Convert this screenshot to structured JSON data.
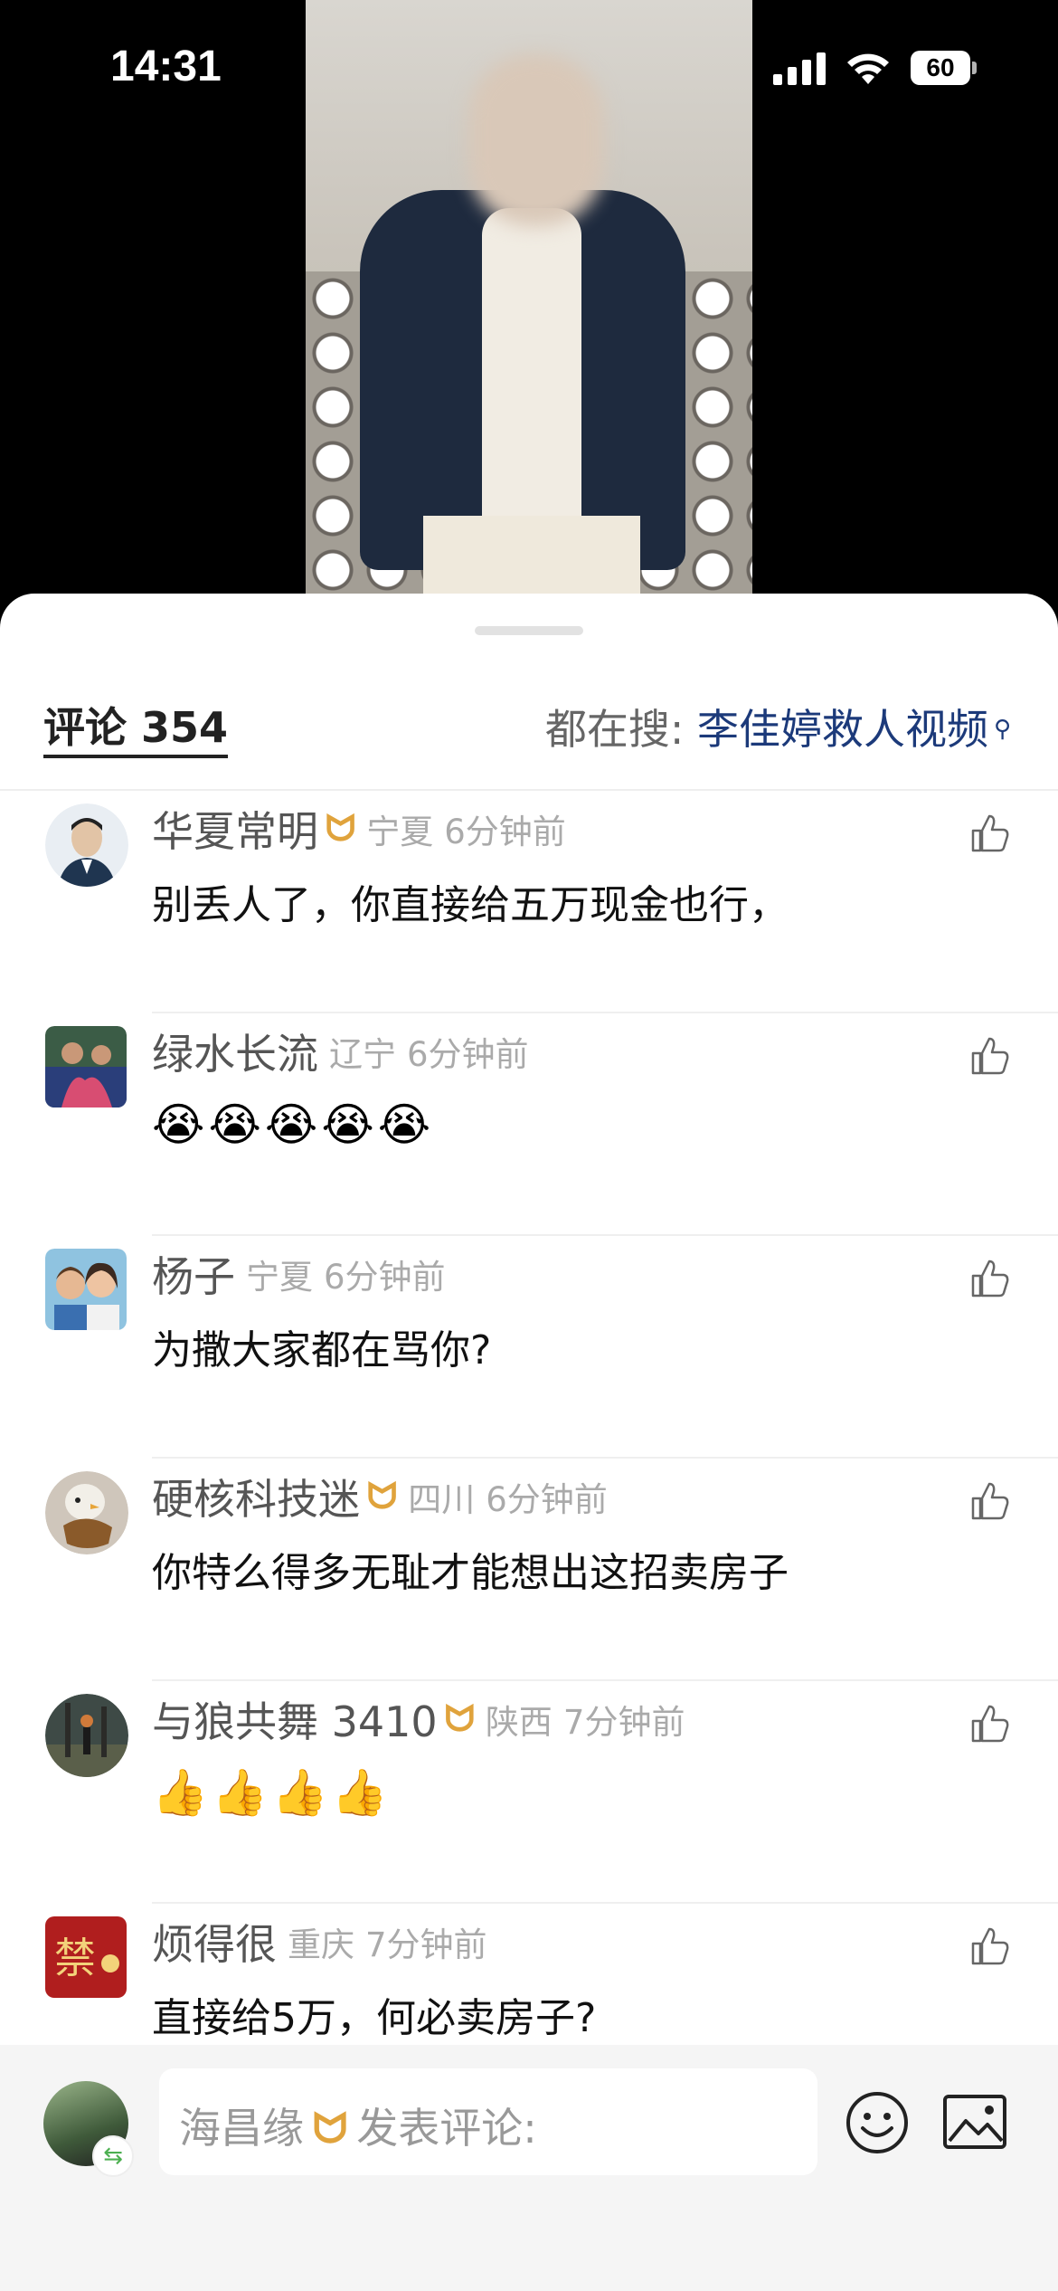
{
  "status": {
    "time": "14:31",
    "battery": "60"
  },
  "header": {
    "comments_label": "评论 354",
    "search_label": "都在搜:",
    "search_term": "李佳婷救人视频",
    "search_icon": "search-icon"
  },
  "comments": [
    {
      "name": "华夏常明",
      "vip": true,
      "region": "宁夏",
      "time": "6分钟前",
      "text": "别丢人了，你直接给五万现金也行，",
      "emojis": []
    },
    {
      "name": "绿水长流",
      "vip": false,
      "region": "辽宁",
      "time": "6分钟前",
      "text": "",
      "emojis": [
        "😭",
        "😭",
        "😭",
        "😭",
        "😭"
      ]
    },
    {
      "name": "杨子",
      "vip": false,
      "region": "宁夏",
      "time": "6分钟前",
      "text": "为撒大家都在骂你?",
      "emojis": []
    },
    {
      "name": "硬核科技迷",
      "vip": true,
      "region": "四川",
      "time": "6分钟前",
      "text": "你特么得多无耻才能想出这招卖房子",
      "emojis": []
    },
    {
      "name": "与狼共舞 3410",
      "vip": true,
      "region": "陕西",
      "time": "7分钟前",
      "text": "",
      "emojis": [
        "👍",
        "👍",
        "👍",
        "👍"
      ]
    },
    {
      "name": "烦得很",
      "vip": false,
      "region": "重庆",
      "time": "7分钟前",
      "text": "直接给5万，何必卖房子?",
      "emojis": []
    }
  ],
  "vip_mark": "ᗢ",
  "avatar_mark": "禁",
  "composer": {
    "user": "海昌缘",
    "placeholder": "发表评论:",
    "vip": true
  }
}
